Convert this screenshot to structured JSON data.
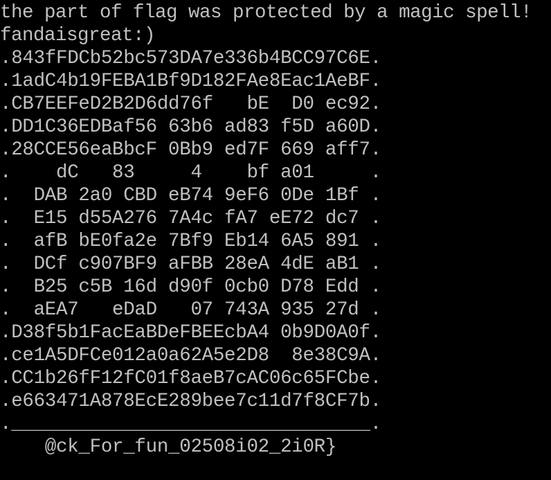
{
  "colors": {
    "background": "#000000",
    "foreground": "#c0c0c0"
  },
  "terminal": {
    "lines": [
      "the part of flag was protected by a magic spell!",
      "fandaisgreat:)",
      ".843fFDCb52bc573DA7e336b4BCC97C6E.",
      ".1adC4b19FEBA1Bf9D182FAe8Eac1AeBF.",
      ".CB7EEFeD2B2D6dd76f   bE  D0 ec92.",
      ".DD1C36EDBaf56 63b6 ad83 f5D a60D.",
      ".28CCE56eaBbcF 0Bb9 ed7F 669 aff7.",
      ".    dC   83     4    bf a01     .",
      ".  DAB 2a0 CBD eB74 9eF6 0De 1Bf .",
      ".  E15 d55A276 7A4c fA7 eE72 dc7 .",
      ".  afB bE0fa2e 7Bf9 Eb14 6A5 891 .",
      ".  DCf c907BF9 aFBB 28eA 4dE aB1 .",
      ".  B25 c5B 16d d90f 0cb0 D78 Edd .",
      ".  aEA7   eDaD   07 743A 935 27d .",
      ".D38f5b1FacEaBDeFBEEcbA4 0b9D0A0f.",
      ".ce1A5DFCe012a0a62A5e2D8  8e38C9A.",
      ".CC1b26fF12fC01f8aeB7cAC06c65FCbe.",
      ".e663471A878EcE289bee7c11d7f8CF7b.",
      ".________________________________.",
      "    @ck_For_fun_02508i02_2i0R}"
    ]
  }
}
